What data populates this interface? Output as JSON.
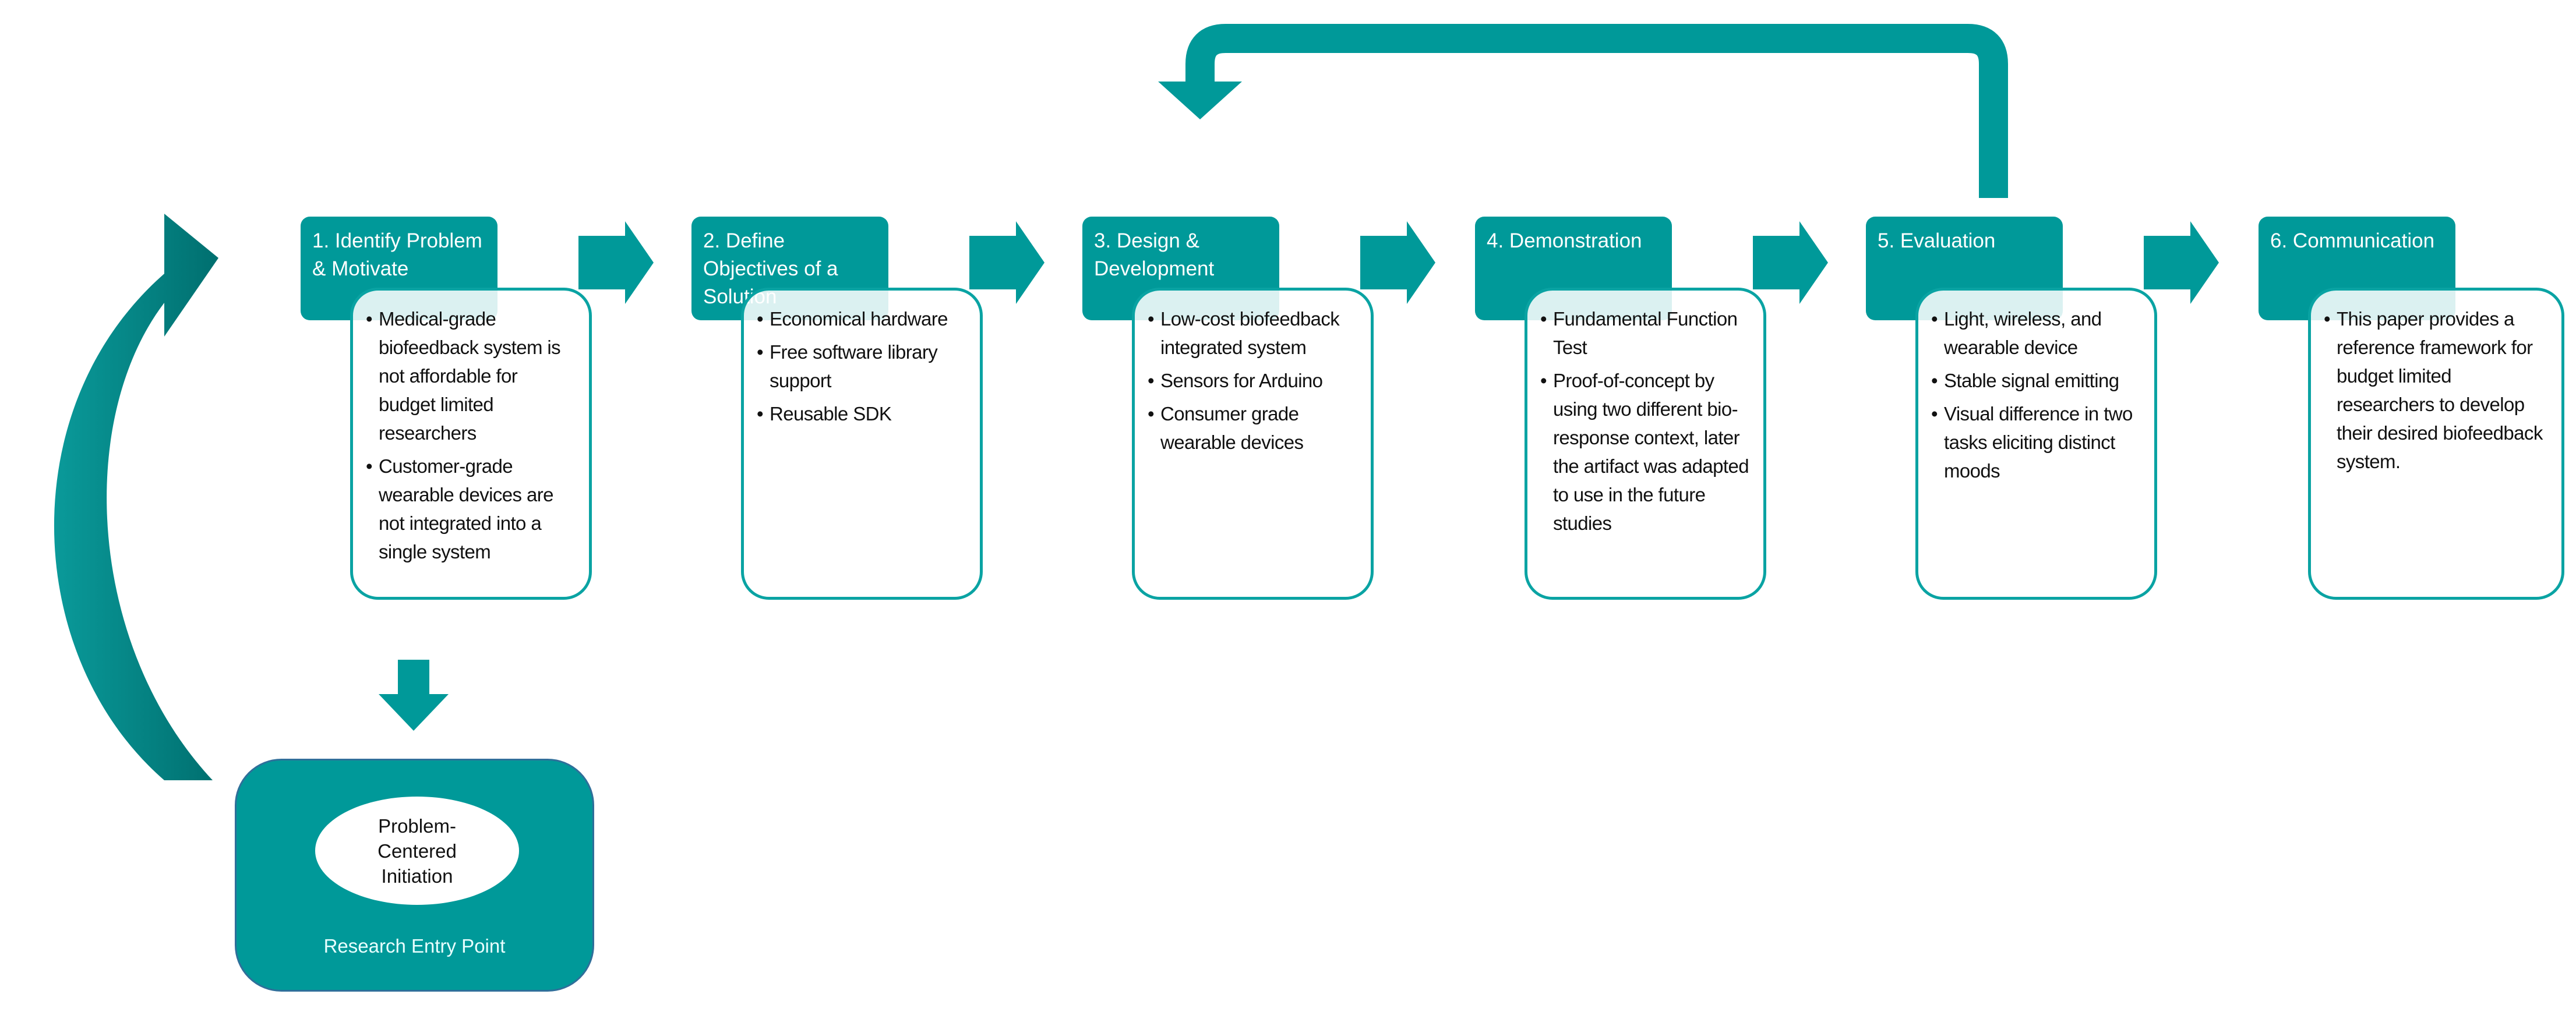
{
  "colors": {
    "primary": "#009999",
    "border": "#0aa3a3",
    "overlap": "#dff5f5"
  },
  "steps": [
    {
      "title": "1. Identify Problem & Motivate",
      "items": [
        "Medical-grade biofeedback system is not affordable for budget limited researchers",
        "Customer-grade wearable devices are not integrated into a single system"
      ]
    },
    {
      "title": "2. Define Objectives of a Solution",
      "items": [
        "Economical hardware",
        "Free software library support",
        "Reusable SDK"
      ]
    },
    {
      "title": "3. Design & Development",
      "items": [
        "Low-cost biofeedback integrated system",
        "Sensors for Arduino",
        "Consumer grade wearable devices"
      ]
    },
    {
      "title": "4. Demonstration",
      "items": [
        "Fundamental  Function  Test",
        "Proof-of-concept by using two different bio-response context, later the artifact was adapted to use in the future studies"
      ]
    },
    {
      "title": "5. Evaluation",
      "items": [
        "Light, wireless, and wearable device",
        "Stable signal emitting",
        "Visual difference in two tasks eliciting distinct moods"
      ]
    },
    {
      "title": "6. Communication",
      "items": [
        "This paper provides a reference framework for budget limited researchers to develop their desired biofeedback system."
      ]
    }
  ],
  "entry": {
    "ellipse_text": "Problem-Centered Initiation",
    "label": "Research Entry Point"
  },
  "icons": {
    "step_arrow": "right-arrow-icon",
    "iteration_arrow": "loop-back-arrow-icon",
    "entry_arrow": "curved-arrow-icon",
    "down_arrow": "down-arrow-icon"
  }
}
